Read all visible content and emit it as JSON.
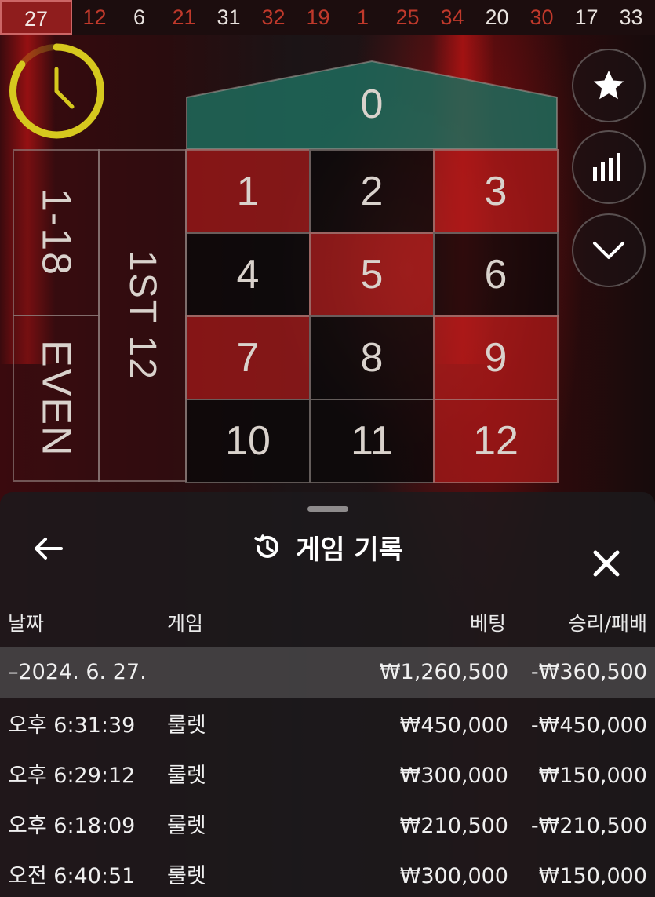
{
  "recent_numbers": [
    {
      "value": "27",
      "color": "red"
    },
    {
      "value": "12",
      "color": "red"
    },
    {
      "value": "6",
      "color": "black"
    },
    {
      "value": "21",
      "color": "red"
    },
    {
      "value": "31",
      "color": "black"
    },
    {
      "value": "32",
      "color": "red"
    },
    {
      "value": "19",
      "color": "red"
    },
    {
      "value": "1",
      "color": "red"
    },
    {
      "value": "25",
      "color": "red"
    },
    {
      "value": "34",
      "color": "red"
    },
    {
      "value": "20",
      "color": "black"
    },
    {
      "value": "30",
      "color": "red"
    },
    {
      "value": "17",
      "color": "black"
    },
    {
      "value": "33",
      "color": "black"
    }
  ],
  "side_buttons": [
    "star-icon",
    "bar-chart-icon",
    "chevron-down-icon"
  ],
  "table": {
    "zero": "0",
    "numbers": [
      {
        "n": "1",
        "color": "red"
      },
      {
        "n": "2",
        "color": "black"
      },
      {
        "n": "3",
        "color": "red"
      },
      {
        "n": "4",
        "color": "black"
      },
      {
        "n": "5",
        "color": "red"
      },
      {
        "n": "6",
        "color": "black"
      },
      {
        "n": "7",
        "color": "red"
      },
      {
        "n": "8",
        "color": "black"
      },
      {
        "n": "9",
        "color": "red"
      },
      {
        "n": "10",
        "color": "black"
      },
      {
        "n": "11",
        "color": "black"
      },
      {
        "n": "12",
        "color": "red"
      }
    ],
    "low_label": "1-18",
    "even_label": "EVEN",
    "dozen_label": "1ST 12"
  },
  "panel": {
    "title": "게임 기록",
    "columns": {
      "date": "날짜",
      "game": "게임",
      "bet": "베팅",
      "result": "승리/패배"
    },
    "date_group": {
      "date": "–2024. 6. 27.",
      "bet": "₩1,260,500",
      "result": "-₩360,500"
    },
    "rows": [
      {
        "time": "오후 6:31:39",
        "game": "룰렛",
        "bet": "₩450,000",
        "result": "-₩450,000"
      },
      {
        "time": "오후 6:29:12",
        "game": "룰렛",
        "bet": "₩300,000",
        "result": "₩150,000"
      },
      {
        "time": "오후 6:18:09",
        "game": "룰렛",
        "bet": "₩210,500",
        "result": "-₩210,500"
      },
      {
        "time": "오전 6:40:51",
        "game": "룰렛",
        "bet": "₩300,000",
        "result": "₩150,000"
      }
    ]
  },
  "colors": {
    "red": "#c0392b",
    "zero_green": "#1f6b5c",
    "timer": "#d6c81e"
  }
}
